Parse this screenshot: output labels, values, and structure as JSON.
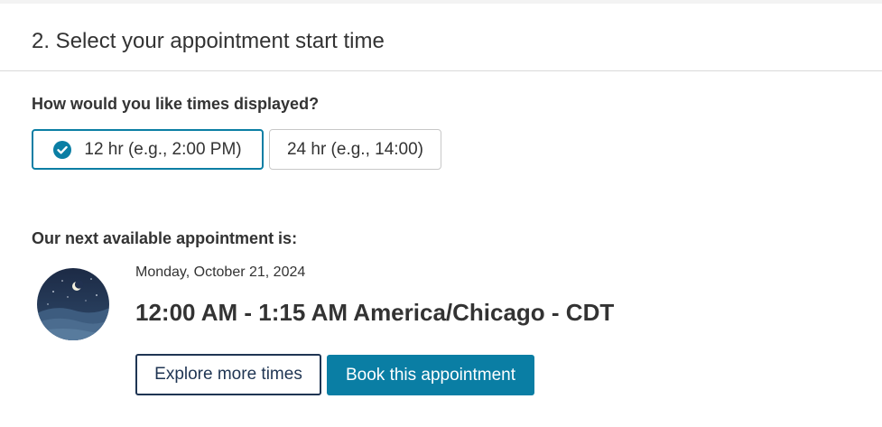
{
  "section": {
    "title": "2. Select your appointment start time"
  },
  "time_format": {
    "question": "How would you like times displayed?",
    "options": [
      {
        "label": "12 hr (e.g., 2:00 PM)",
        "selected": true
      },
      {
        "label": "24 hr (e.g., 14:00)",
        "selected": false
      }
    ]
  },
  "next_appointment": {
    "title": "Our next available appointment is:",
    "date": "Monday, October 21, 2024",
    "time": "12:00 AM - 1:15 AM America/Chicago - CDT",
    "avatar_icon": "night-moon-icon"
  },
  "actions": {
    "explore_label": "Explore more times",
    "book_label": "Book this appointment"
  },
  "colors": {
    "accent": "#0a7ea4",
    "navy": "#1f3553",
    "text": "#333333"
  }
}
